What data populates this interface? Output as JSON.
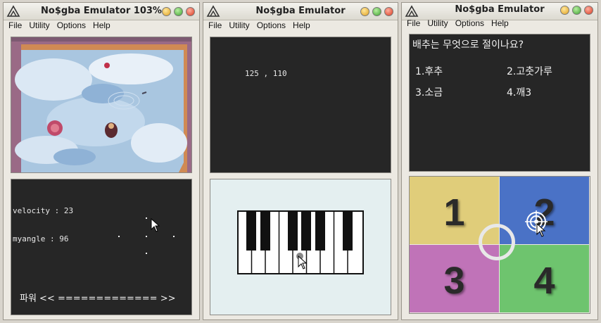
{
  "windows": [
    {
      "title": "No$gba Emulator 103%",
      "menu": [
        "File",
        "Utility",
        "Options",
        "Help"
      ],
      "bottom_screen": {
        "velocity": "velocity : 23",
        "angle": "myangle : 96",
        "power": "파워 << ============= >>"
      }
    },
    {
      "title": "No$gba Emulator",
      "menu": [
        "File",
        "Utility",
        "Options",
        "Help"
      ],
      "top_screen": {
        "coords": "125 , 110"
      }
    },
    {
      "title": "No$gba Emulator",
      "menu": [
        "File",
        "Utility",
        "Options",
        "Help"
      ],
      "top_screen": {
        "question": "배추는 무엇으로 절이나요?",
        "answers": [
          "1.후추",
          "2.고춧가루",
          "3.소금",
          "4.깨3"
        ]
      },
      "bottom_screen": {
        "quadrants": [
          {
            "label": "1",
            "color": "#e0cd7a"
          },
          {
            "label": "2",
            "color": "#4a72c6"
          },
          {
            "label": "3",
            "color": "#c073b8"
          },
          {
            "label": "4",
            "color": "#6ec46e"
          }
        ]
      }
    }
  ],
  "colors": {
    "screen_dark": "#262626",
    "piano_bg": "#e4eff0",
    "water": "#a9c6e0",
    "sand": "#d08a54"
  }
}
